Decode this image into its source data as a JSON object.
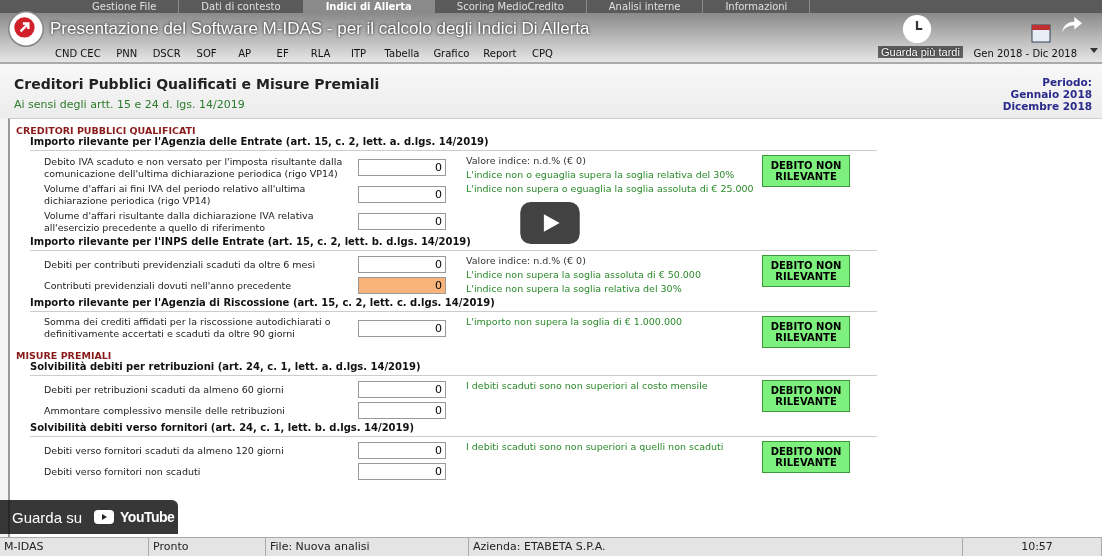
{
  "video": {
    "title": "Presentazione del Software M-IDAS - per il calcolo degli Indici Di Allerta",
    "watch_later": "Guarda più tardi",
    "watch_on": "Guarda su",
    "platform": "YouTube"
  },
  "tabs": [
    {
      "label": "Gestione File",
      "selected": false
    },
    {
      "label": "Dati di contesto",
      "selected": false
    },
    {
      "label": "Indici di Allerta",
      "selected": true
    },
    {
      "label": "Scoring MedioCredito",
      "selected": false
    },
    {
      "label": "Analisi interne",
      "selected": false
    },
    {
      "label": "Informazioni",
      "selected": false
    }
  ],
  "toolbar": [
    {
      "label": "CND CEC"
    },
    {
      "label": "PNN"
    },
    {
      "label": "DSCR"
    },
    {
      "label": "SOF"
    },
    {
      "label": "AP"
    },
    {
      "label": "EF"
    },
    {
      "label": "RLA"
    },
    {
      "label": "ITP"
    },
    {
      "label": "Tabella"
    },
    {
      "label": "Grafico"
    },
    {
      "label": "Report"
    },
    {
      "label": "CPQ"
    }
  ],
  "period_picker": "Gen 2018 - Dic 2018",
  "header": {
    "title": "Creditori Pubblici Qualificati e Misure Premiali",
    "subtitle": "Ai sensi degli artt. 15 e 24 d. lgs. 14/2019",
    "period_label": "Periodo:",
    "period_from": "Gennaio 2018",
    "period_to": "Dicembre 2018"
  },
  "sections": [
    {
      "title": "CREDITORI PUBBLICI QUALIFICATI",
      "groups": [
        {
          "title": "Importo rilevante per l'Agenzia delle Entrate (art. 15, c. 2, lett. a. d.lgs. 14/2019)",
          "rows": [
            {
              "label": "Debito IVA scaduto e non versato per l'imposta risultante dalla comunicazione dell'ultima dichiarazione periodica (rigo VP14)",
              "value": "0",
              "highlighted": false
            },
            {
              "label": "Volume d'affari ai fini IVA del periodo relativo all'ultima dichiarazione periodica (rigo VP14)",
              "value": "0",
              "highlighted": false
            },
            {
              "label": "Volume d'affari risultante dalla dichiarazione IVA relativa all'esercizio precedente a quello di riferimento",
              "value": "0",
              "highlighted": false
            }
          ],
          "notes": [
            {
              "text": "Valore indice: n.d.% (€ 0)",
              "kind": "value"
            },
            {
              "text": "L'indice non o eguaglia supera la soglia relativa del 30%",
              "kind": "ok"
            },
            {
              "text": "L'indice non supera o eguaglia la soglia assoluta di € 25.000",
              "kind": "ok"
            }
          ],
          "status": "DEBITO NON RILEVANTE"
        },
        {
          "title": "Importo rilevante per l'INPS delle Entrate (art. 15, c. 2, lett. b. d.lgs. 14/2019)",
          "rows": [
            {
              "label": "Debiti per contributi previdenziali scaduti da oltre 6 mesi",
              "value": "0",
              "highlighted": false
            },
            {
              "label": "Contributi previdenziali dovuti nell'anno precedente",
              "value": "0",
              "highlighted": true
            }
          ],
          "notes": [
            {
              "text": "Valore indice: n.d.% (€ 0)",
              "kind": "value"
            },
            {
              "text": "L'indice non supera la soglia assoluta di € 50.000",
              "kind": "ok"
            },
            {
              "text": "L'indice non supera la soglia relativa del 30%",
              "kind": "ok"
            }
          ],
          "status": "DEBITO NON RILEVANTE"
        },
        {
          "title": "Importo rilevante per l'Agenzia di Riscossione (art. 15, c. 2, lett. c. d.lgs. 14/2019)",
          "rows": [
            {
              "label": "Somma dei crediti affidati per la riscossione autodichiarati o definitivamente accertati e scaduti da oltre 90 giorni",
              "value": "0",
              "highlighted": false
            }
          ],
          "notes": [
            {
              "text": "L'importo non supera la soglia di € 1.000.000",
              "kind": "ok"
            }
          ],
          "status": "DEBITO NON RILEVANTE"
        }
      ]
    },
    {
      "title": "MISURE PREMIALI",
      "groups": [
        {
          "title": "Solvibilità debiti per retribuzioni (art. 24, c. 1, lett. a. d.lgs. 14/2019)",
          "rows": [
            {
              "label": "Debiti per retribuzioni scaduti da almeno 60 giorni",
              "value": "0",
              "highlighted": false
            },
            {
              "label": "Ammontare complessivo mensile delle retribuzioni",
              "value": "0",
              "highlighted": false
            }
          ],
          "notes": [
            {
              "text": "I debiti scaduti sono non superiori al costo mensile",
              "kind": "ok"
            }
          ],
          "status": "DEBITO NON RILEVANTE"
        },
        {
          "title": "Solvibilità debiti verso fornitori (art. 24, c. 1, lett. b. d.lgs. 14/2019)",
          "rows": [
            {
              "label": "Debiti verso fornitori scaduti da almeno 120 giorni",
              "value": "0",
              "highlighted": false
            },
            {
              "label": "Debiti verso fornitori non scaduti",
              "value": "0",
              "highlighted": false
            }
          ],
          "notes": [
            {
              "text": "I debiti scaduti sono non superiori a quelli non scaduti",
              "kind": "ok"
            }
          ],
          "status": "DEBITO NON RILEVANTE"
        }
      ]
    }
  ],
  "status_bar": [
    "M-IDAS",
    "Pronto",
    "File: Nuova analisi",
    "Azienda: ETABETA S.P.A.",
    "10:57"
  ]
}
